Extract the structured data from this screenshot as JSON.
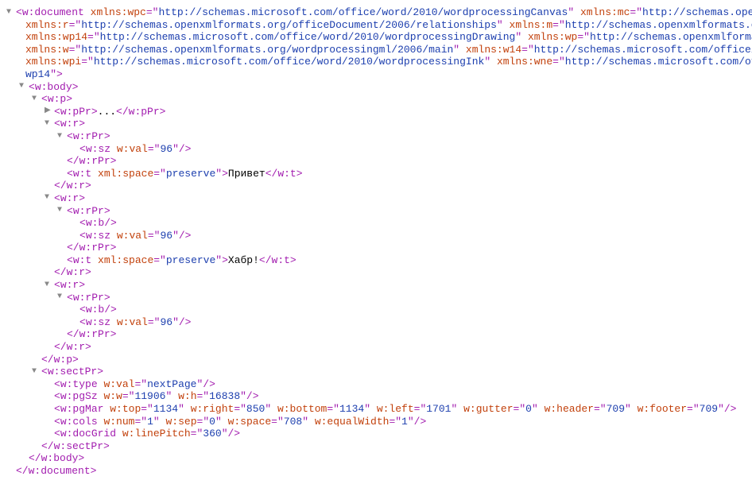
{
  "arrows": {
    "down": "▼",
    "right": "▶"
  },
  "lines": {
    "l1_tag": "w:document",
    "l1_a1_n": "xmlns:wpc",
    "l1_a1_v": "http://schemas.microsoft.com/office/word/2010/wordprocessingCanvas",
    "l1_a2_n": "xmlns:mc",
    "l1_a2_v": "http://schemas.ope",
    "l2_a1_n": "xmlns:r",
    "l2_a1_v": "http://schemas.openxmlformats.org/officeDocument/2006/relationships",
    "l2_a2_n": "xmlns:m",
    "l2_a2_v": "http://schemas.openxmlformats.or",
    "l3_a1_n": "xmlns:wp14",
    "l3_a1_v": "http://schemas.microsoft.com/office/word/2010/wordprocessingDrawing",
    "l3_a2_n": "xmlns:wp",
    "l3_a2_v": "http://schemas.openxmlformat",
    "l4_a1_n": "xmlns:w",
    "l4_a1_v": "http://schemas.openxmlformats.org/wordprocessingml/2006/main",
    "l4_a2_n": "xmlns:w14",
    "l4_a2_v": "http://schemas.microsoft.com/office/w",
    "l5_a1_n": "xmlns:wpi",
    "l5_a1_v": "http://schemas.microsoft.com/office/word/2010/wordprocessingInk",
    "l5_a2_n": "xmlns:wne",
    "l5_a2_v": "http://schemas.microsoft.com/off",
    "l6_v": "wp14",
    "body_tag": "w:body",
    "p_tag": "w:p",
    "ppr_tag": "w:pPr",
    "ellipsis": "...",
    "r_tag": "w:r",
    "rpr_tag": "w:rPr",
    "sz_tag": "w:sz",
    "sz_attr": "w:val",
    "sz_val": "96",
    "t_tag": "w:t",
    "t_attr": "xml:space",
    "t_val": "preserve",
    "t_text1": "Привет",
    "t_text2": "Хабр!",
    "b_tag": "w:b",
    "sectpr_tag": "w:sectPr",
    "type_tag": "w:type",
    "type_attr": "w:val",
    "type_val": "nextPage",
    "pgsz_tag": "w:pgSz",
    "pgsz_a1": "w:w",
    "pgsz_v1": "11906",
    "pgsz_a2": "w:h",
    "pgsz_v2": "16838",
    "pgmar_tag": "w:pgMar",
    "pgmar_a1": "w:top",
    "pgmar_v1": "1134",
    "pgmar_a2": "w:right",
    "pgmar_v2": "850",
    "pgmar_a3": "w:bottom",
    "pgmar_v3": "1134",
    "pgmar_a4": "w:left",
    "pgmar_v4": "1701",
    "pgmar_a5": "w:gutter",
    "pgmar_v5": "0",
    "pgmar_a6": "w:header",
    "pgmar_v6": "709",
    "pgmar_a7": "w:footer",
    "pgmar_v7": "709",
    "cols_tag": "w:cols",
    "cols_a1": "w:num",
    "cols_v1": "1",
    "cols_a2": "w:sep",
    "cols_v2": "0",
    "cols_a3": "w:space",
    "cols_v3": "708",
    "cols_a4": "w:equalWidth",
    "cols_v4": "1",
    "docgrid_tag": "w:docGrid",
    "docgrid_a1": "w:linePitch",
    "docgrid_v1": "360"
  }
}
